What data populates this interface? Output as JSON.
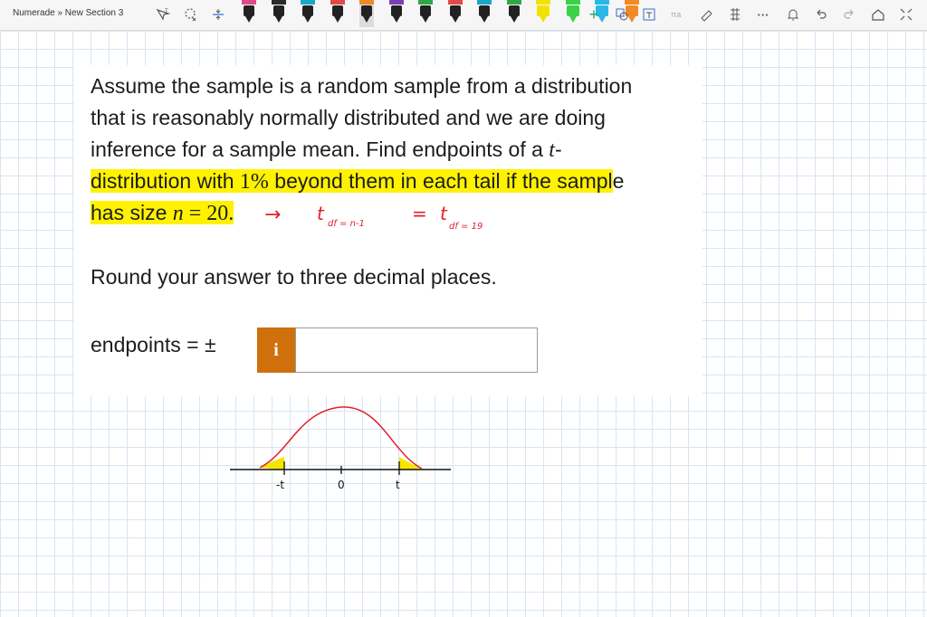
{
  "toolbar": {
    "breadcrumb": "Numerade » New Section 3",
    "tools": [
      "lasso-select-icon",
      "lasso-icon",
      "insert-space-icon"
    ],
    "pens": [
      {
        "band": "#e04a8a",
        "body": "#222222"
      },
      {
        "band": "#2a2a2a",
        "body": "#222222"
      },
      {
        "band": "#1aa8c8",
        "body": "#222222"
      },
      {
        "band": "#e04a4a",
        "body": "#222222"
      },
      {
        "band": "#f08a24",
        "body": "#222222"
      },
      {
        "band": "#7a3fb8",
        "body": "#222222"
      },
      {
        "band": "#2fa84a",
        "body": "#222222"
      },
      {
        "band": "#e04a4a",
        "body": "#222222"
      },
      {
        "band": "#1aa8c8",
        "body": "#222222"
      },
      {
        "band": "#2fa84a",
        "body": "#222222"
      },
      {
        "band": "#f2e200",
        "body": "#222222"
      },
      {
        "band": "#39d24a",
        "body": "#222222"
      },
      {
        "band": "#2ab8e8",
        "body": "#222222"
      },
      {
        "band": "#f08a24",
        "body": "#222222"
      }
    ],
    "right_icons": [
      "add-pen-icon",
      "ink-to-shape-icon",
      "ink-to-text-icon",
      "ink-to-math-icon",
      "ruler-icon",
      "replay-icon",
      "more-icon",
      "bell-icon",
      "undo-icon",
      "redo-icon",
      "share-icon",
      "fullscreen-icon"
    ],
    "more_label": "···"
  },
  "question": {
    "line1": "Assume the sample is a random sample from a distribution",
    "line2": "that is reasonably normally distributed and we are doing",
    "line3_a": "inference for a sample mean. Find endpoints of a ",
    "line3_t": "t",
    "line3_b": "-",
    "line4_a": "distribution with ",
    "line4_pct": "1%",
    "line4_b": " beyond them in each tail if the sampl",
    "line4_c": "e",
    "line5_a": "has size ",
    "line5_n": "n",
    "line5_eq": " = 20.",
    "round": "Round your answer to three decimal places.",
    "answer_label": "endpoints = ±",
    "info_label": "i",
    "answer_value": ""
  },
  "handwriting": {
    "arrow": "→",
    "t_sub1": "t",
    "sub1": "df = n-1",
    "eq": "=",
    "t_sub2": "t",
    "sub2": "df = 19"
  },
  "sketch": {
    "left_label": "-t",
    "center_label": "0",
    "right_label": "t",
    "curve_color": "#e0202a",
    "shade_color": "#f5e600"
  }
}
